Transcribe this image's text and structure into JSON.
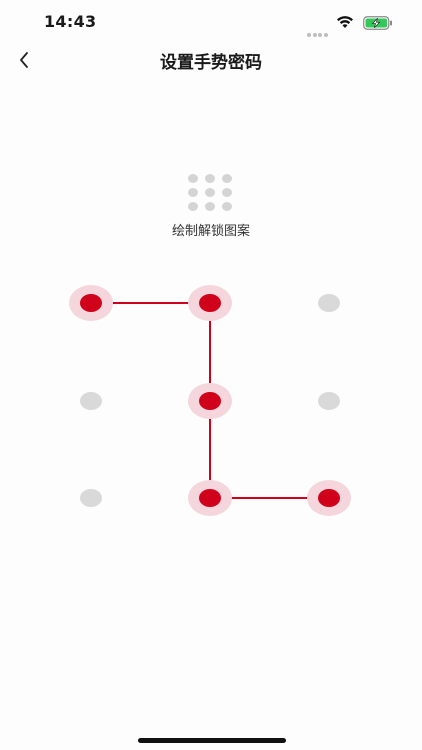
{
  "status_bar": {
    "time": "14:43",
    "signal_icon": "signal-dots-icon",
    "wifi_icon": "wifi-icon",
    "battery_icon": "battery-charging-icon",
    "battery_color": "#34c759"
  },
  "nav": {
    "back_icon": "chevron-left-icon",
    "title": "设置手势密码"
  },
  "hint": {
    "preview_icon": "pattern-grid-icon",
    "text": "绘制解锁图案"
  },
  "pattern": {
    "accent_color": "#d0021b",
    "halo_color": "#f5d6dc",
    "inactive_color": "#d9d9d9",
    "selected_sequence": [
      1,
      2,
      5,
      8,
      9
    ],
    "dots": [
      {
        "index": 1,
        "selected": true
      },
      {
        "index": 2,
        "selected": true
      },
      {
        "index": 3,
        "selected": false
      },
      {
        "index": 4,
        "selected": false
      },
      {
        "index": 5,
        "selected": true
      },
      {
        "index": 6,
        "selected": false
      },
      {
        "index": 7,
        "selected": false
      },
      {
        "index": 8,
        "selected": true
      },
      {
        "index": 9,
        "selected": true
      }
    ]
  }
}
